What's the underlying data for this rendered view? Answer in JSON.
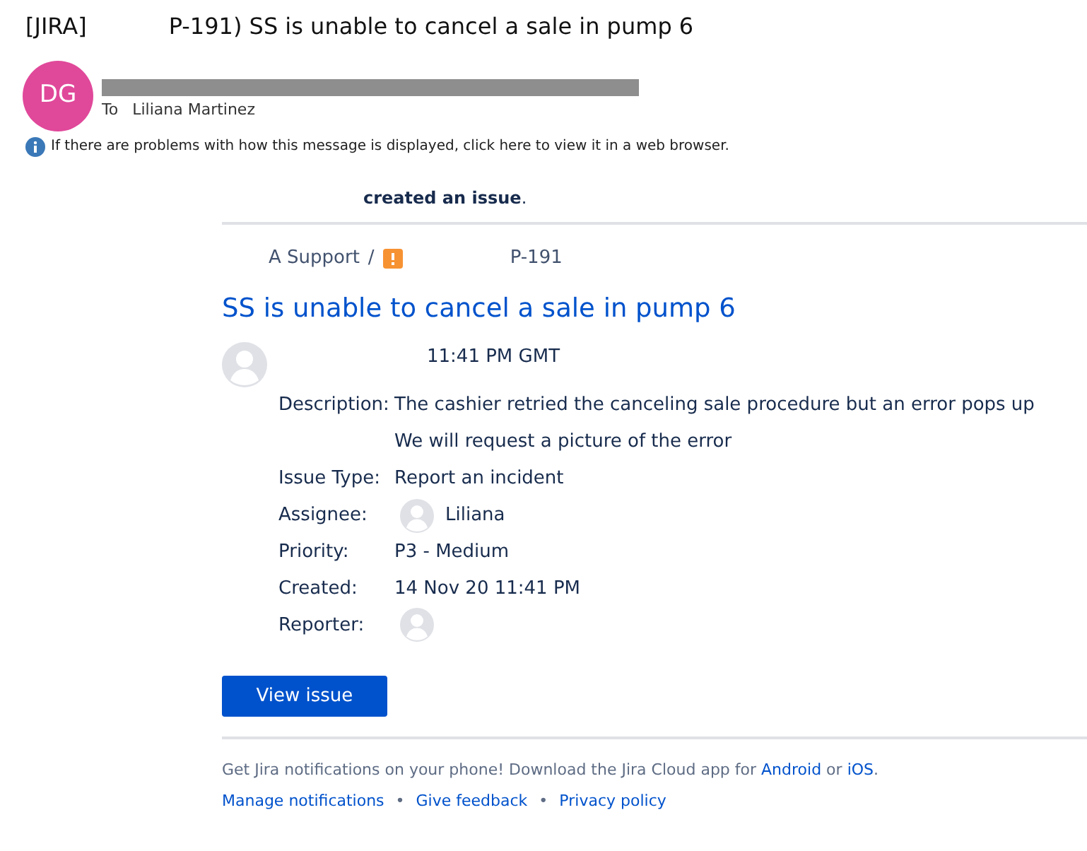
{
  "subject": {
    "prefix": "[JIRA]",
    "rest": "P-191)  SS is unable to cancel a sale in pump 6"
  },
  "sender": {
    "initials": "DG",
    "color": "#e0489a",
    "redacted": true,
    "to_label": "To",
    "to": "Liliana Martinez"
  },
  "info_bar": "If there are problems with how this message is displayed, click here to view it in a web browser.",
  "action": "created an issue",
  "action_end": ".",
  "breadcrumb": {
    "project": "A Support",
    "separator": "/",
    "issue_key": "P-191"
  },
  "issue_title": "SS is unable to cancel a sale in pump 6",
  "timestamp": "11:41 PM GMT",
  "fields": [
    {
      "kind": "text",
      "label": "Description:",
      "lines": [
        "The cashier retried the canceling sale procedure but an error pops up",
        "We will request a picture of the error"
      ]
    },
    {
      "kind": "text",
      "label": "Issue Type:",
      "lines": [
        "Report an incident"
      ]
    },
    {
      "kind": "user",
      "label": "Assignee:",
      "name": "Liliana"
    },
    {
      "kind": "text",
      "label": "Priority:",
      "lines": [
        "P3 - Medium"
      ]
    },
    {
      "kind": "text",
      "label": "Created:",
      "lines": [
        "14 Nov 20 11:41 PM"
      ]
    },
    {
      "kind": "user",
      "label": "Reporter:"
    }
  ],
  "button": "View issue",
  "footer": {
    "text": "Get Jira notifications on your phone! Download the Jira Cloud app for",
    "link1": "Android",
    "middle": "or",
    "link2": "iOS",
    "end": ".",
    "links": [
      "Manage notifications",
      "Give feedback",
      "Privacy policy"
    ],
    "separator": "•"
  }
}
